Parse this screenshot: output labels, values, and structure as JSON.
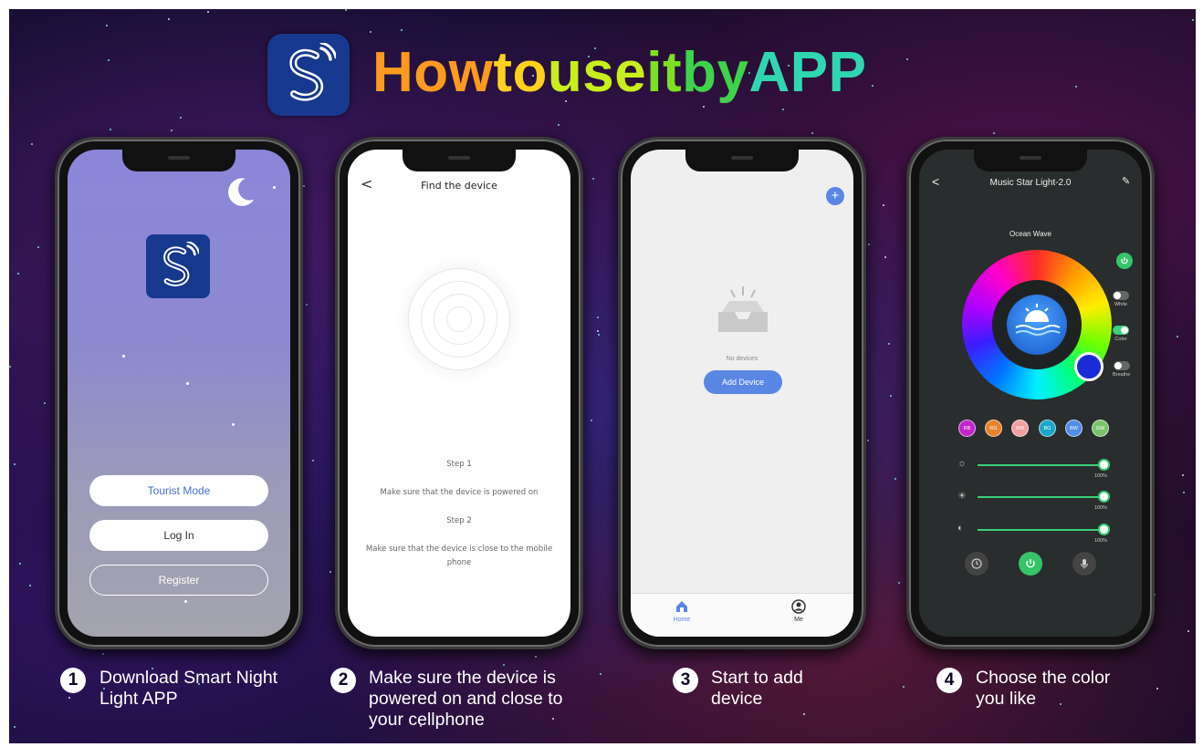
{
  "header": {
    "title_parts": [
      {
        "text": "How ",
        "color": "#ff9a1f"
      },
      {
        "text": "to ",
        "color": "#ffd21a"
      },
      {
        "text": "use ",
        "color": "#c8ee1c"
      },
      {
        "text": "it ",
        "color": "#7de024"
      },
      {
        "text": "by ",
        "color": "#3ed34a"
      },
      {
        "text": "APP",
        "color": "#2fd7b0"
      }
    ],
    "logo_icon": "s-signal-logo-icon"
  },
  "phone1": {
    "moon_icon": "moon-icon",
    "logo_icon": "s-signal-logo-icon",
    "tourist_mode": "Tourist Mode",
    "log_in": "Log In",
    "register": "Register"
  },
  "phone2": {
    "back": "<",
    "title": "Find the device",
    "step1_title": "Step 1",
    "step1_text": "Make sure that the device is powered on",
    "step2_title": "Step 2",
    "step2_text": "Make sure that the device is close to the mobile phone"
  },
  "phone3": {
    "add_icon": "+",
    "no_devices": "No devices",
    "add_device": "Add Device",
    "tabs": [
      {
        "label": "Home",
        "icon": "home-icon",
        "color": "#5a86e4"
      },
      {
        "label": "Me",
        "icon": "user-icon",
        "color": "#333333"
      }
    ]
  },
  "phone4": {
    "back": "<",
    "title": "Music Star Light-2.0",
    "edit_icon": "✎",
    "mode_name": "Ocean Wave",
    "toggles": [
      {
        "label": "White",
        "on": false
      },
      {
        "label": "Color",
        "on": true
      },
      {
        "label": "Breathe",
        "on": false
      }
    ],
    "chips": [
      {
        "label": "RB",
        "color": "#c326c8"
      },
      {
        "label": "RG",
        "color": "#e7822b"
      },
      {
        "label": "RW",
        "color": "#f2a0a0"
      },
      {
        "label": "BG",
        "color": "#1aa6c8"
      },
      {
        "label": "BW",
        "color": "#4f8ee6"
      },
      {
        "label": "GW",
        "color": "#79c46b"
      }
    ],
    "sliders": [
      {
        "icon": "brightness-low-icon",
        "percent": "100%"
      },
      {
        "icon": "brightness-high-icon",
        "percent": "100%"
      },
      {
        "icon": "contrast-icon",
        "percent": "100%"
      }
    ],
    "bottom_icons": [
      "clock-icon",
      "power-icon",
      "microphone-icon"
    ]
  },
  "captions": [
    {
      "num": "1",
      "line1": "Download Smart Night",
      "line2": "Light APP",
      "line3": ""
    },
    {
      "num": "2",
      "line1": "Make sure the device is",
      "line2": "powered on  and close to",
      "line3": "your cellphone"
    },
    {
      "num": "3",
      "line1": "Start to add",
      "line2": "device",
      "line3": ""
    },
    {
      "num": "4",
      "line1": "Choose the color",
      "line2": "you like",
      "line3": ""
    }
  ]
}
